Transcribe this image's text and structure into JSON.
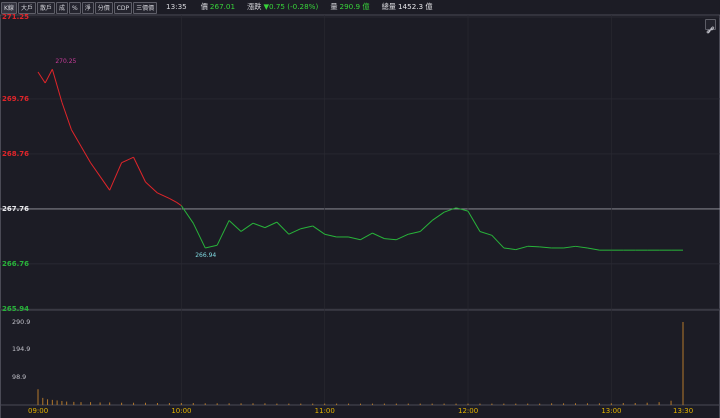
{
  "toolbar": {
    "tabs": [
      "K線",
      "大戶",
      "散戶",
      "成",
      "%",
      "淨",
      "分價",
      "CDP",
      "三價價"
    ]
  },
  "quote": {
    "time": "13:35",
    "price_label": "價",
    "price": "267.01",
    "change_label": "漲跌",
    "change": "▼0.75 (-0.28%)",
    "volume_label": "量",
    "volume": "290.9 億",
    "total_label": "總量",
    "total": "1452.3 億"
  },
  "colors": {
    "up": "#e0252a",
    "down": "#28b43a",
    "accent": "#e2b200",
    "volume_bar": "#b3782b"
  },
  "chart_data": [
    {
      "type": "line",
      "title": "",
      "ylim": [
        265.94,
        271.25
      ],
      "reference": 267.76,
      "y_ticks": [
        "271.25",
        "269.76",
        "268.76",
        "267.76",
        "266.76",
        "265.94"
      ],
      "x_ticks": [
        "09:00",
        "10:00",
        "11:00",
        "12:00",
        "13:00",
        "13:30"
      ],
      "annotations": {
        "high": "270.25",
        "low": "266.94"
      },
      "x": [
        0,
        3,
        6,
        10,
        14,
        18,
        22,
        26,
        30,
        35,
        40,
        45,
        50,
        55,
        58,
        60,
        65,
        70,
        75,
        80,
        85,
        90,
        95,
        100,
        105,
        110,
        115,
        120,
        125,
        130,
        135,
        140,
        145,
        150,
        155,
        160,
        165,
        170,
        175,
        180,
        185,
        190,
        195,
        200,
        205,
        210,
        215,
        220,
        225,
        230,
        235,
        240,
        245,
        250,
        255,
        260,
        265,
        270
      ],
      "values": [
        270.25,
        270.05,
        270.3,
        269.7,
        269.2,
        268.9,
        268.6,
        268.35,
        268.1,
        268.6,
        268.7,
        268.25,
        268.05,
        267.95,
        267.88,
        267.82,
        267.5,
        267.05,
        267.1,
        267.55,
        267.35,
        267.5,
        267.42,
        267.52,
        267.3,
        267.4,
        267.45,
        267.3,
        267.25,
        267.25,
        267.2,
        267.32,
        267.22,
        267.2,
        267.3,
        267.35,
        267.55,
        267.7,
        267.78,
        267.72,
        267.35,
        267.28,
        267.05,
        267.02,
        267.08,
        267.07,
        267.05,
        267.05,
        267.08,
        267.05,
        267.01,
        267.01,
        267.01,
        267.01,
        267.01,
        267.01,
        267.01,
        267.01
      ]
    },
    {
      "type": "bar",
      "title": "",
      "ylim": [
        0,
        290.9
      ],
      "y_ticks": [
        "290.9",
        "194.9",
        "98.9"
      ],
      "x": [
        0,
        2,
        4,
        6,
        8,
        10,
        12,
        15,
        18,
        22,
        26,
        30,
        35,
        40,
        45,
        50,
        55,
        60,
        65,
        70,
        75,
        80,
        85,
        90,
        95,
        100,
        105,
        110,
        115,
        120,
        125,
        130,
        135,
        140,
        145,
        150,
        155,
        160,
        165,
        170,
        175,
        180,
        185,
        190,
        195,
        200,
        205,
        210,
        215,
        220,
        225,
        230,
        235,
        240,
        245,
        250,
        255,
        260,
        265,
        270
      ],
      "values": [
        55,
        25,
        20,
        18,
        16,
        14,
        12,
        11,
        10,
        10,
        9,
        9,
        8,
        8,
        8,
        7,
        7,
        7,
        7,
        6,
        6,
        6,
        6,
        6,
        6,
        5,
        5,
        5,
        5,
        5,
        5,
        5,
        5,
        5,
        5,
        5,
        5,
        5,
        5,
        5,
        5,
        5,
        5,
        5,
        5,
        5,
        5,
        5,
        6,
        6,
        6,
        6,
        6,
        6,
        7,
        7,
        8,
        10,
        15,
        290.9
      ]
    }
  ]
}
